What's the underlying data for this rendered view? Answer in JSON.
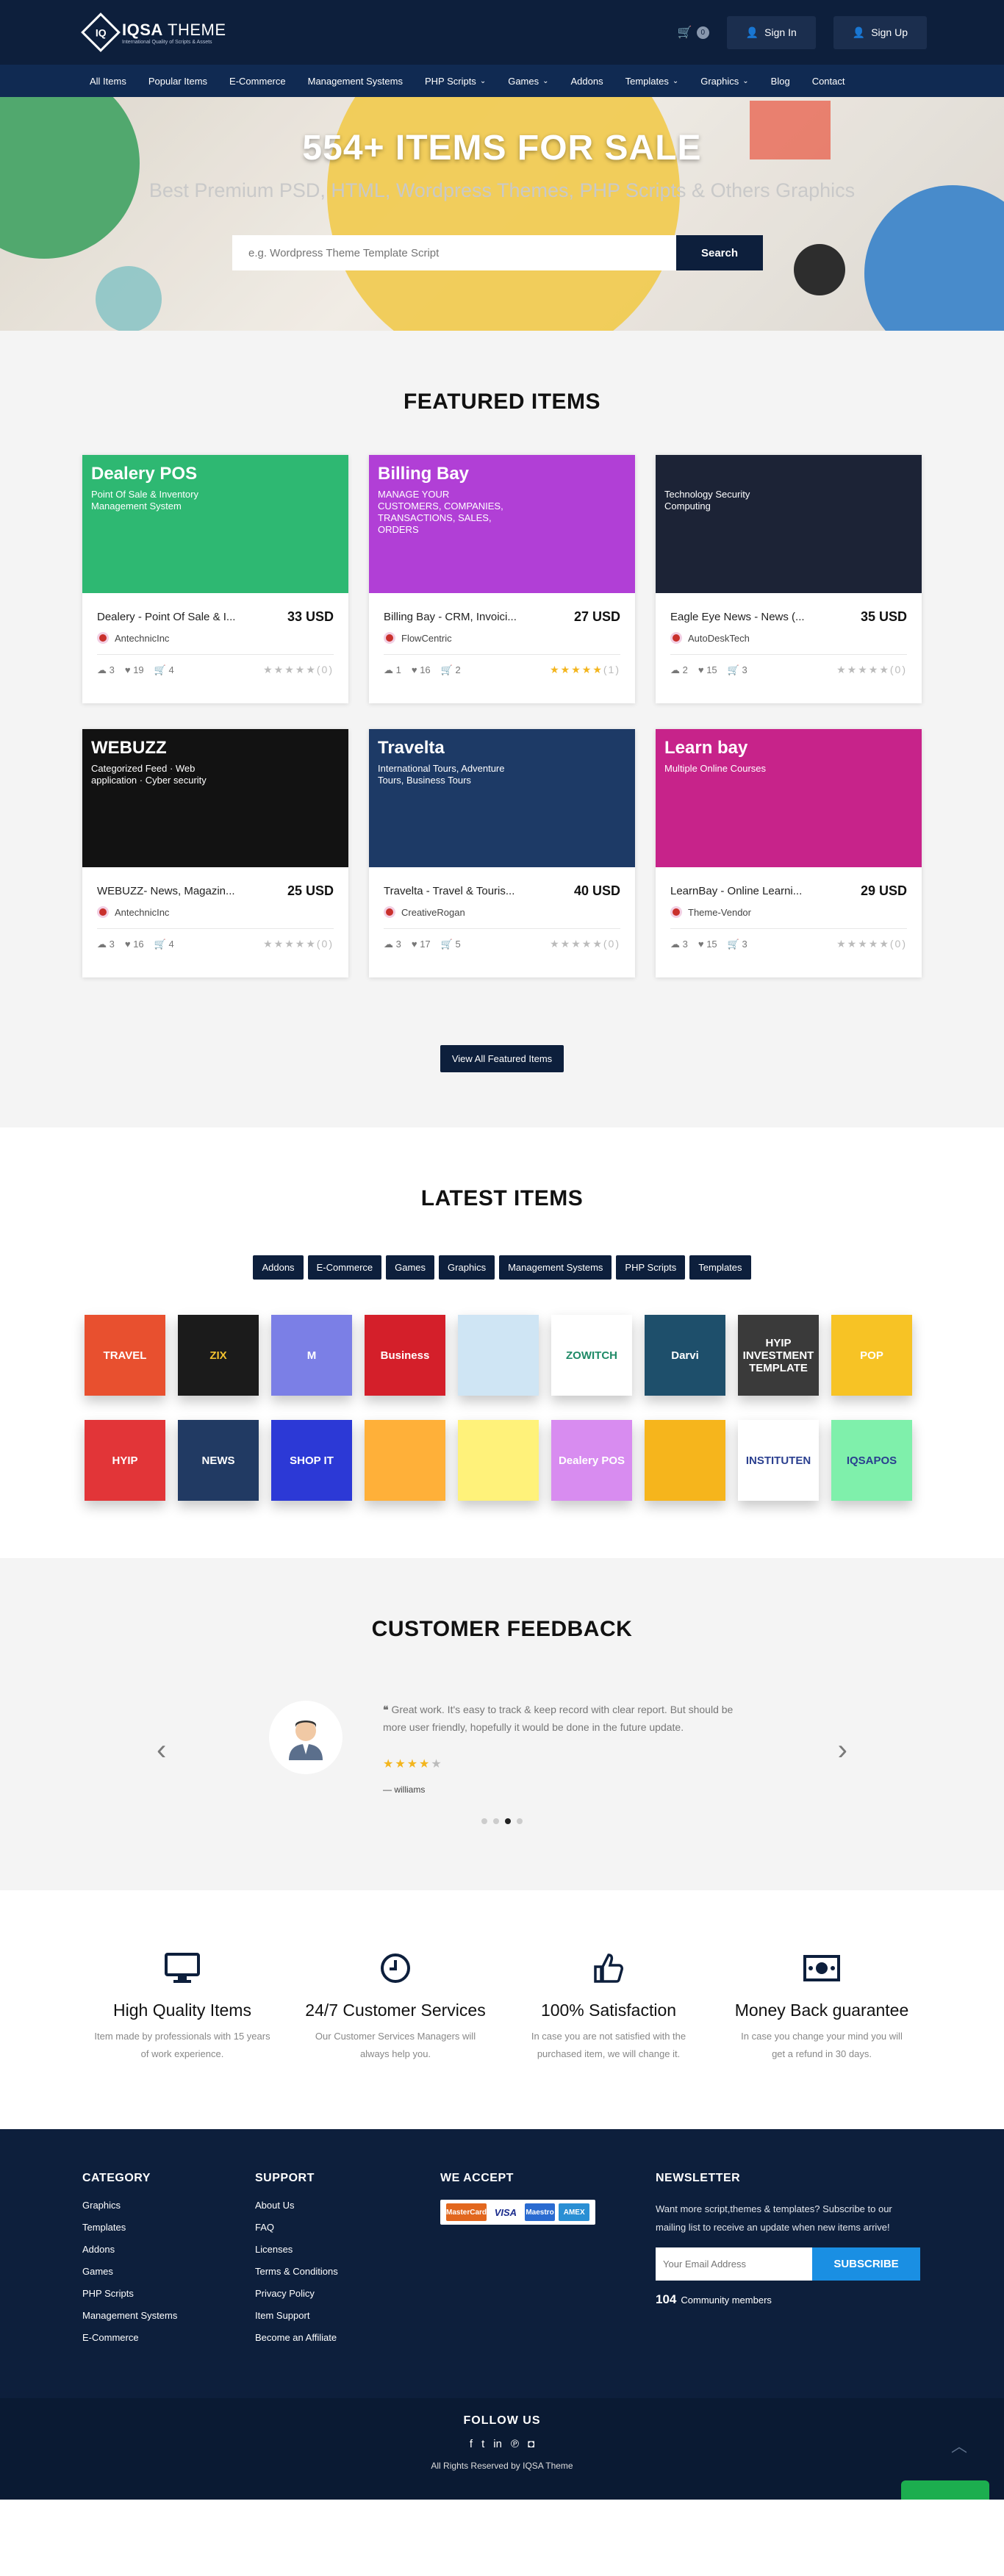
{
  "brand": {
    "mark": "IQ",
    "name_bold": "IQSA",
    "name_light": " THEME",
    "tagline": "International Quality of Scripts & Assets"
  },
  "header": {
    "cart_count": "0",
    "signin": "Sign In",
    "signup": "Sign Up"
  },
  "nav": [
    {
      "label": "All Items"
    },
    {
      "label": "Popular Items"
    },
    {
      "label": "E-Commerce"
    },
    {
      "label": "Management Systems"
    },
    {
      "label": "PHP Scripts",
      "dropdown": true
    },
    {
      "label": "Games",
      "dropdown": true
    },
    {
      "label": "Addons"
    },
    {
      "label": "Templates",
      "dropdown": true
    },
    {
      "label": "Graphics",
      "dropdown": true
    },
    {
      "label": "Blog"
    },
    {
      "label": "Contact"
    }
  ],
  "hero": {
    "title": "554+ ITEMS FOR SALE",
    "subtitle": "Best Premium PSD, HTML, Wordpress Themes, PHP Scripts & Others Graphics",
    "placeholder": "e.g. Wordpress Theme Template Script",
    "button": "Search"
  },
  "featured": {
    "title": "FEATURED ITEMS",
    "view_all": "View All Featured Items",
    "items": [
      {
        "name": "Dealery - Point Of Sale & I...",
        "price": "33 USD",
        "author": "AntechnicInc",
        "downloads": "3",
        "likes": "19",
        "sales": "4",
        "rating": 0,
        "rating_count": "(0)",
        "thumb_title": "Dealery POS",
        "thumb_sub": "Point Of Sale & Inventory Management System",
        "bg": "#2eb872"
      },
      {
        "name": "Billing Bay - CRM, Invoici...",
        "price": "27 USD",
        "author": "FlowCentric",
        "downloads": "1",
        "likes": "16",
        "sales": "2",
        "rating": 5,
        "rating_count": "(1)",
        "thumb_title": "Billing Bay",
        "thumb_sub": "MANAGE YOUR CUSTOMERS, COMPANIES, TRANSACTIONS, SALES, ORDERS",
        "bg": "#b13fd6"
      },
      {
        "name": "Eagle Eye News - News (...",
        "price": "35 USD",
        "author": "AutoDeskTech",
        "downloads": "2",
        "likes": "15",
        "sales": "3",
        "rating": 0,
        "rating_count": "(0)",
        "thumb_title": "",
        "thumb_sub": "Technology Security Computing",
        "bg": "#1c2336"
      },
      {
        "name": "WEBUZZ- News, Magazin...",
        "price": "25 USD",
        "author": "AntechnicInc",
        "downloads": "3",
        "likes": "16",
        "sales": "4",
        "rating": 0,
        "rating_count": "(0)",
        "thumb_title": "WEBUZZ",
        "thumb_sub": "Categorized Feed · Web application · Cyber security",
        "bg": "#121212"
      },
      {
        "name": "Travelta - Travel & Touris...",
        "price": "40 USD",
        "author": "CreativeRogan",
        "downloads": "3",
        "likes": "17",
        "sales": "5",
        "rating": 0,
        "rating_count": "(0)",
        "thumb_title": "Travelta",
        "thumb_sub": "International Tours, Adventure Tours, Business Tours",
        "bg": "#1d3a66"
      },
      {
        "name": "LearnBay - Online Learni...",
        "price": "29 USD",
        "author": "Theme-Vendor",
        "downloads": "3",
        "likes": "15",
        "sales": "3",
        "rating": 0,
        "rating_count": "(0)",
        "thumb_title": "Learn bay",
        "thumb_sub": "Multiple Online Courses",
        "bg": "#c7238a"
      }
    ]
  },
  "latest": {
    "title": "LATEST ITEMS",
    "categories": [
      "Addons",
      "E-Commerce",
      "Games",
      "Graphics",
      "Management Systems",
      "PHP Scripts",
      "Templates"
    ],
    "tiles": [
      {
        "label": "TRAVEL",
        "bg": "#e8502f"
      },
      {
        "label": "ZIX",
        "bg": "#1b1b1b",
        "fg": "#f2c230"
      },
      {
        "label": "M",
        "bg": "#7b7fe6"
      },
      {
        "label": "Business",
        "bg": "#d41f2a"
      },
      {
        "label": "",
        "bg": "#cfe5f4"
      },
      {
        "label": "ZOWITCH",
        "bg": "#ffffff",
        "fg": "#1f8a67"
      },
      {
        "label": "Darvi",
        "bg": "#1e4f6b"
      },
      {
        "label": "HYIP INVESTMENT TEMPLATE",
        "bg": "#3a3a3a"
      },
      {
        "label": "POP",
        "bg": "#f7c325"
      },
      {
        "label": "HYIP",
        "bg": "#e23538"
      },
      {
        "label": "NEWS",
        "bg": "#213a63"
      },
      {
        "label": "SHOP IT",
        "bg": "#2c39d6"
      },
      {
        "label": "",
        "bg": "#ffb039"
      },
      {
        "label": "",
        "bg": "#fff27a"
      },
      {
        "label": "Dealery POS",
        "bg": "#d88cf0"
      },
      {
        "label": "",
        "bg": "#f6b51c"
      },
      {
        "label": "INSTITUTEN",
        "bg": "#ffffff",
        "fg": "#2a3f8f"
      },
      {
        "label": "IQSAPOS",
        "bg": "#7ff0ab",
        "fg": "#2a3f8f"
      }
    ]
  },
  "feedback": {
    "title": "CUSTOMER FEEDBACK",
    "quote": "Great work. It's easy to track & keep record with clear report. But should be more user friendly, hopefully it would be done in the future update.",
    "rating": 4,
    "author": "williams"
  },
  "features": [
    {
      "icon": "monitor-icon",
      "title": "High Quality Items",
      "text": "Item made by professionals with 15 years of work experience."
    },
    {
      "icon": "clock-icon",
      "title": "24/7 Customer Services",
      "text": "Our Customer Services Managers will always help you."
    },
    {
      "icon": "thumbs-up-icon",
      "title": "100% Satisfaction",
      "text": "In case you are not satisfied with the purchased item, we will change it."
    },
    {
      "icon": "money-icon",
      "title": "Money Back guarantee",
      "text": "In case you change your mind you will get a refund in 30 days."
    }
  ],
  "footer": {
    "category": {
      "title": "CATEGORY",
      "links": [
        "Graphics",
        "Templates",
        "Addons",
        "Games",
        "PHP Scripts",
        "Management Systems",
        "E-Commerce"
      ]
    },
    "support": {
      "title": "SUPPORT",
      "links": [
        "About Us",
        "FAQ",
        "Licenses",
        "Terms & Conditions",
        "Privacy Policy",
        "Item Support",
        "Become an Affiliate"
      ]
    },
    "accept": {
      "title": "WE ACCEPT",
      "cards": [
        "MasterCard",
        "VISA",
        "Maestro",
        "AMEX"
      ]
    },
    "newsletter": {
      "title": "NEWSLETTER",
      "text": "Want more script,themes & templates? Subscribe to our mailing list to receive an update when new items arrive!",
      "placeholder": "Your Email Address",
      "button": "SUBSCRIBE",
      "count": "104",
      "count_label": "Community members"
    }
  },
  "bottom": {
    "follow": "FOLLOW US",
    "copyright": "All Rights Reserved by IQSA Theme"
  },
  "colors": {
    "navy": "#0d1f3c",
    "accent": "#1a8fe3",
    "star": "#f3b51d"
  }
}
